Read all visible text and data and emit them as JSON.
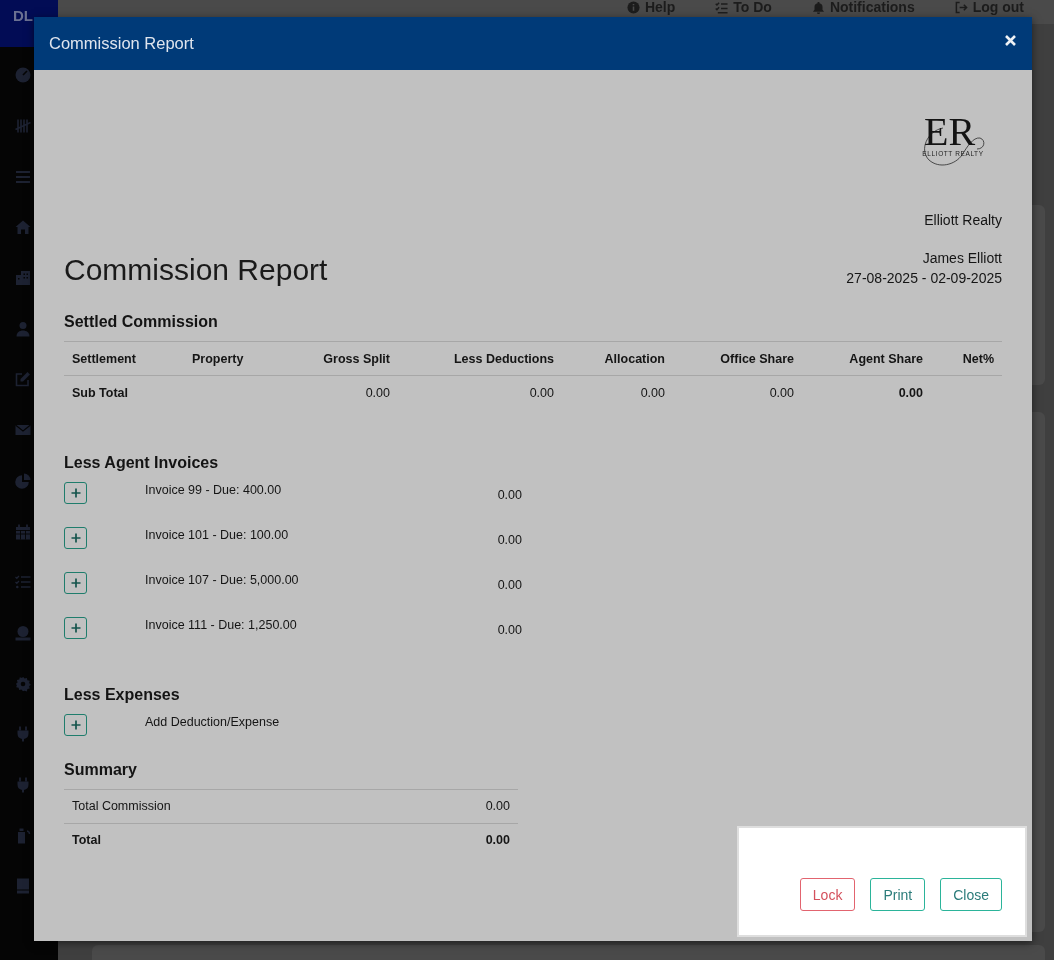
{
  "sidebar": {
    "logo_text": "DL"
  },
  "top_bar": {
    "links": [
      {
        "label": "Help"
      },
      {
        "label": "To Do"
      },
      {
        "label": "Notifications"
      },
      {
        "label": "Log out"
      }
    ]
  },
  "modal": {
    "title": "Commission Report"
  },
  "report": {
    "logo": {
      "initials": "ER",
      "tagline": "ELLIOTT REALTY"
    },
    "company": "Elliott Realty",
    "heading": "Commission Report",
    "agent": "James Elliott",
    "period": "27-08-2025 - 02-09-2025"
  },
  "settled_commission": {
    "title": "Settled Commission",
    "columns": [
      "Settlement",
      "Property",
      "Gross Split",
      "Less Deductions",
      "Allocation",
      "Office Share",
      "Agent Share",
      "Net%"
    ],
    "subtotal": {
      "label": "Sub Total",
      "gross_split": "0.00",
      "less_deductions": "0.00",
      "allocation": "0.00",
      "office_share": "0.00",
      "agent_share": "0.00"
    }
  },
  "agent_invoices": {
    "title": "Less Agent Invoices",
    "items": [
      {
        "label": "Invoice 99 - Due: 400.00",
        "amount": "0.00"
      },
      {
        "label": "Invoice 101 - Due: 100.00",
        "amount": "0.00"
      },
      {
        "label": "Invoice 107 - Due: 5,000.00",
        "amount": "0.00"
      },
      {
        "label": "Invoice 111 - Due: 1,250.00",
        "amount": "0.00"
      }
    ]
  },
  "expenses": {
    "title": "Less Expenses",
    "add_label": "Add Deduction/Expense"
  },
  "summary": {
    "title": "Summary",
    "rows": [
      {
        "label": "Total Commission",
        "value": "0.00",
        "total": false
      },
      {
        "label": "Total",
        "value": "0.00",
        "total": true
      }
    ]
  },
  "footer": {
    "buttons": [
      {
        "label": "Lock",
        "kind": "danger"
      },
      {
        "label": "Print",
        "kind": "secondary"
      },
      {
        "label": "Close",
        "kind": "secondary"
      }
    ]
  }
}
